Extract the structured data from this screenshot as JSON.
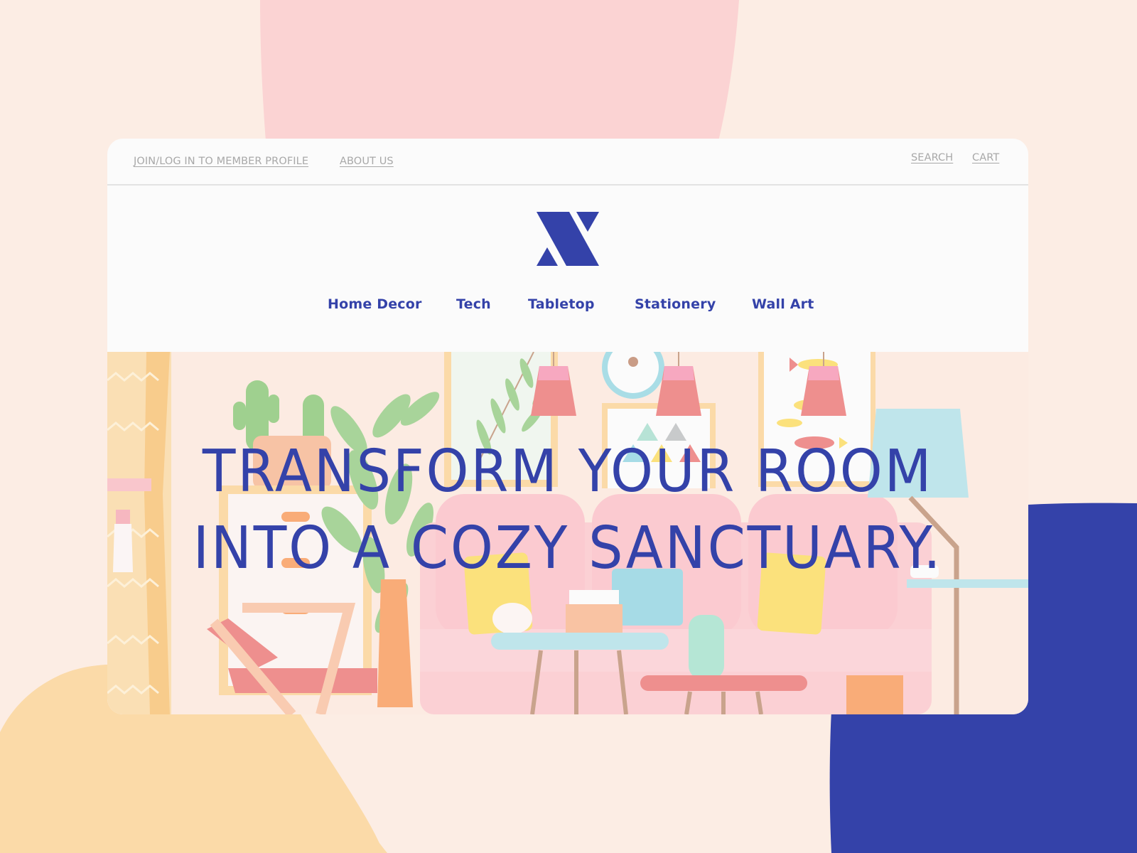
{
  "theme": {
    "brand_color": "#3442a9",
    "background": "#fcede4",
    "blob_pink": "#fbd3d3",
    "blob_yellow": "#fbdaa8",
    "blob_blue": "#3442a9"
  },
  "topbar": {
    "left_links": [
      {
        "label": "JOIN/LOG IN TO MEMBER PROFILE"
      },
      {
        "label": "ABOUT US"
      }
    ],
    "right_links": [
      {
        "label": "SEARCH"
      },
      {
        "label": "CART"
      }
    ]
  },
  "logo": {
    "icon": "x-logo-icon"
  },
  "nav": {
    "items": [
      {
        "label": "Home Decor"
      },
      {
        "label": "Tech"
      },
      {
        "label": "Tabletop"
      },
      {
        "label": "Stationery"
      },
      {
        "label": "Wall Art"
      }
    ]
  },
  "hero": {
    "headline_line1": "TRANSFORM YOUR ROOM",
    "headline_line2": "INTO A COZY SANCTUARY.",
    "illustration": "living-room-illustration"
  }
}
